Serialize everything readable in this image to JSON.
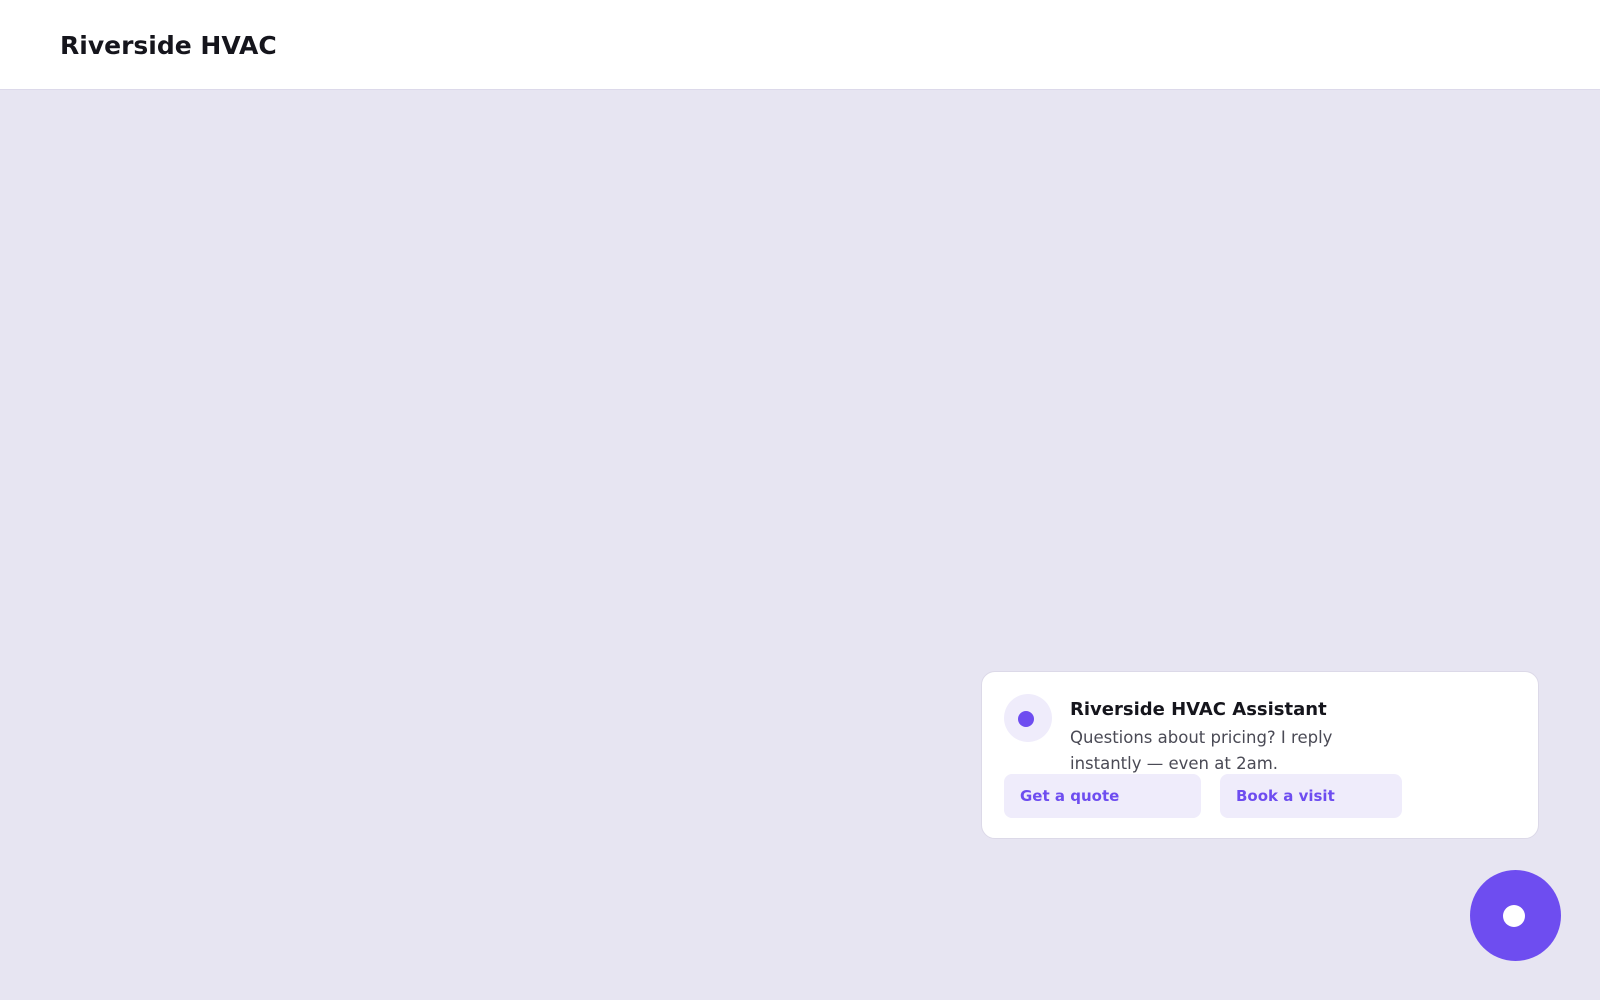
{
  "header": {
    "brand": "Riverside HVAC"
  },
  "chat_widget": {
    "title": "Riverside HVAC Assistant",
    "message": "Questions about pricing? I reply instantly — even at 2am.",
    "quick_replies": [
      {
        "label": "Get a quote"
      },
      {
        "label": "Book a visit"
      }
    ],
    "avatar_icon": "dot-icon",
    "launcher_icon": "chat-launcher-icon"
  },
  "colors": {
    "accent": "#6e4df0",
    "accent_light": "#efecfb",
    "page_background": "#e7e5f2",
    "text_primary": "#15151c",
    "text_secondary": "#4a4a55"
  }
}
